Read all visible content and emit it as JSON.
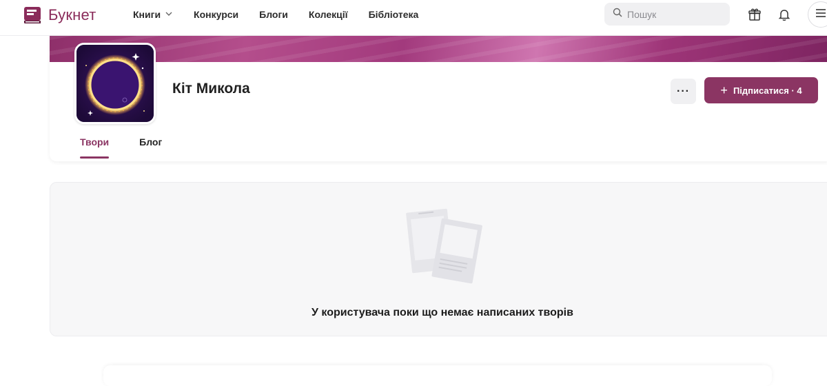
{
  "header": {
    "logo_text": "Букнет",
    "nav": [
      {
        "label": "Книги",
        "has_dropdown": true
      },
      {
        "label": "Конкурси"
      },
      {
        "label": "Блоги"
      },
      {
        "label": "Колекції"
      },
      {
        "label": "Бібліотека"
      }
    ],
    "search": {
      "placeholder": "Пошук",
      "icon": "search-icon"
    },
    "icons": [
      "gift-icon",
      "bell-icon",
      "menu-icon"
    ]
  },
  "profile": {
    "name": "Кіт Микола",
    "more_label": "···",
    "subscribe_label": "Підписатися · 4",
    "tabs": [
      {
        "label": "Твори",
        "active": true
      },
      {
        "label": "Блог",
        "active": false
      }
    ]
  },
  "empty_state": {
    "message": "У користувача поки що немає написаних творів"
  },
  "colors": {
    "accent": "#8b3563",
    "logo": "#8a2b5a"
  }
}
